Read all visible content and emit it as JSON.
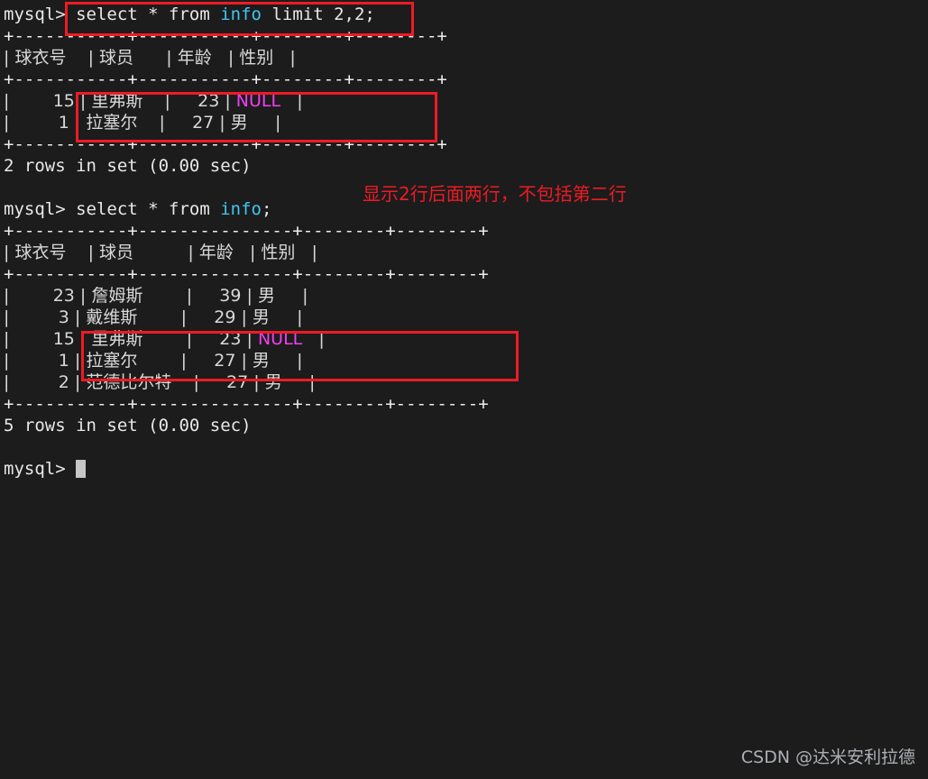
{
  "window": {
    "background_color": "#1c1c1c",
    "foreground_color": "#e8e8e8",
    "accent_identifier_color": "#3fc7f4",
    "null_color": "#f23ff2",
    "annotation_color": "#ee1b24",
    "watermark_color": "#b9bcc2"
  },
  "terminal": {
    "prompt": "mysql>",
    "lines": [
      {
        "id": "l01",
        "kind": "prompt-command",
        "prompt": "mysql> ",
        "pre": "select * from ",
        "ident": "info",
        "post": " limit 2,2;"
      },
      {
        "id": "l02",
        "kind": "border",
        "text": "+-----------+-----------+--------+--------+"
      },
      {
        "id": "l03",
        "kind": "header",
        "text": "| 球衣号    | 球员      | 年龄   | 性别   |"
      },
      {
        "id": "l04",
        "kind": "border",
        "text": "+-----------+-----------+--------+--------+"
      },
      {
        "id": "l05",
        "kind": "row-null",
        "pre": "|        15 | 里弗斯    |     23 | ",
        "null": "NULL",
        "post": "   |"
      },
      {
        "id": "l06",
        "kind": "row",
        "text": "|         1 | 拉塞尔    |     27 | 男     |"
      },
      {
        "id": "l07",
        "kind": "border",
        "text": "+-----------+-----------+--------+--------+"
      },
      {
        "id": "l08",
        "kind": "status",
        "text": "2 rows in set (0.00 sec)"
      },
      {
        "id": "l09",
        "kind": "blank",
        "text": ""
      },
      {
        "id": "l10",
        "kind": "prompt-command",
        "prompt": "mysql> ",
        "pre": "select * from ",
        "ident": "info",
        "post": ";"
      },
      {
        "id": "l11",
        "kind": "border",
        "text": "+-----------+---------------+--------+--------+"
      },
      {
        "id": "l12",
        "kind": "header",
        "text": "| 球衣号    | 球员          | 年龄   | 性别   |"
      },
      {
        "id": "l13",
        "kind": "border",
        "text": "+-----------+---------------+--------+--------+"
      },
      {
        "id": "l14",
        "kind": "row",
        "text": "|        23 | 詹姆斯        |     39 | 男     |"
      },
      {
        "id": "l15",
        "kind": "row",
        "text": "|         3 | 戴维斯        |     29 | 男     |"
      },
      {
        "id": "l16",
        "kind": "row-null",
        "pre": "|        15 | 里弗斯        |     23 | ",
        "null": "NULL",
        "post": "   |"
      },
      {
        "id": "l17",
        "kind": "row",
        "text": "|         1 | 拉塞尔        |     27 | 男     |"
      },
      {
        "id": "l18",
        "kind": "row",
        "text": "|         2 | 范德比尔特    |     27 | 男     |"
      },
      {
        "id": "l19",
        "kind": "border",
        "text": "+-----------+---------------+--------+--------+"
      },
      {
        "id": "l20",
        "kind": "status",
        "text": "5 rows in set (0.00 sec)"
      },
      {
        "id": "l21",
        "kind": "blank",
        "text": ""
      },
      {
        "id": "l22",
        "kind": "prompt-cursor",
        "prompt": "mysql> "
      }
    ]
  },
  "queries": [
    {
      "command": "select * from info limit 2,2;",
      "result_status": "2 rows in set (0.00 sec)",
      "columns": [
        "球衣号",
        "球员",
        "年龄",
        "性别"
      ],
      "rows": [
        [
          "15",
          "里弗斯",
          "23",
          "NULL"
        ],
        [
          "1",
          "拉塞尔",
          "27",
          "男"
        ]
      ]
    },
    {
      "command": "select * from info;",
      "result_status": "5 rows in set (0.00 sec)",
      "columns": [
        "球衣号",
        "球员",
        "年龄",
        "性别"
      ],
      "rows": [
        [
          "23",
          "詹姆斯",
          "39",
          "男"
        ],
        [
          "3",
          "戴维斯",
          "29",
          "男"
        ],
        [
          "15",
          "里弗斯",
          "23",
          "NULL"
        ],
        [
          "1",
          "拉塞尔",
          "27",
          "男"
        ],
        [
          "2",
          "范德比尔特",
          "27",
          "男"
        ]
      ]
    }
  ],
  "annotations": {
    "note_text": "显示2行后面两行，不包括第二行",
    "boxes": [
      {
        "id": "box-command",
        "label": "highlight-first-query-command"
      },
      {
        "id": "box-result-rows",
        "label": "highlight-first-query-rows"
      },
      {
        "id": "box-matching-rows",
        "label": "highlight-matching-rows-in-full-table"
      }
    ]
  },
  "watermark": {
    "text": "CSDN @达米安利拉德"
  }
}
